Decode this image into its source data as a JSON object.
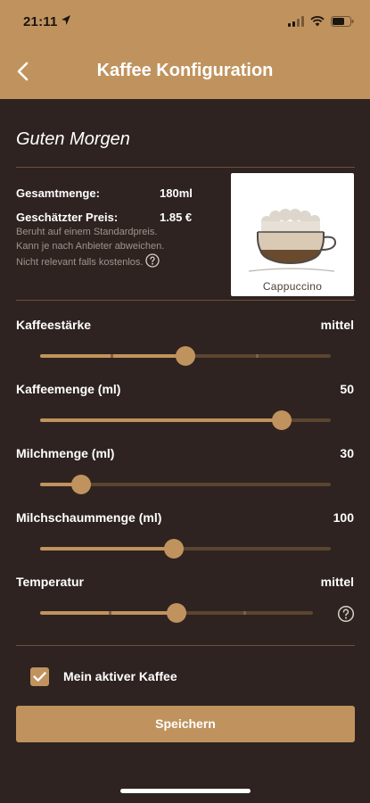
{
  "status_bar": {
    "time": "21:11",
    "icons": [
      "location-arrow-icon",
      "signal-icon",
      "wifi-icon",
      "battery-icon"
    ]
  },
  "header": {
    "title": "Kaffee Konfiguration",
    "back_icon": "chevron-left-icon"
  },
  "greeting": "Guten Morgen",
  "summary": {
    "total_label": "Gesamtmenge:",
    "total_value": "180ml",
    "price_label": "Geschätzter Preis:",
    "price_value": "1.85 €",
    "note_line1": "Beruht auf einem Standardpreis.",
    "note_line2": "Kann je nach Anbieter abweichen.",
    "note_line3": "Nicht relevant falls kostenlos.",
    "help_icon": "question-circle-icon"
  },
  "drink": {
    "name": "Cappuccino"
  },
  "sliders": [
    {
      "label": "Kaffeestärke",
      "value": "mittel",
      "fraction": 0.5
    },
    {
      "label": "Kaffeemenge (ml)",
      "value": "50",
      "fraction": 0.83
    },
    {
      "label": "Milchmenge (ml)",
      "value": "30",
      "fraction": 0.14
    },
    {
      "label": "Milchschaummenge (ml)",
      "value": "100",
      "fraction": 0.46
    },
    {
      "label": "Temperatur",
      "value": "mittel",
      "fraction": 0.5
    }
  ],
  "active_coffee": {
    "label": "Mein aktiver Kaffee",
    "checked": true
  },
  "save_button": "Speichern",
  "colors": {
    "accent": "#c0935e",
    "background": "#2e2320",
    "track": "#5a4530",
    "note_text": "#9e948c"
  }
}
